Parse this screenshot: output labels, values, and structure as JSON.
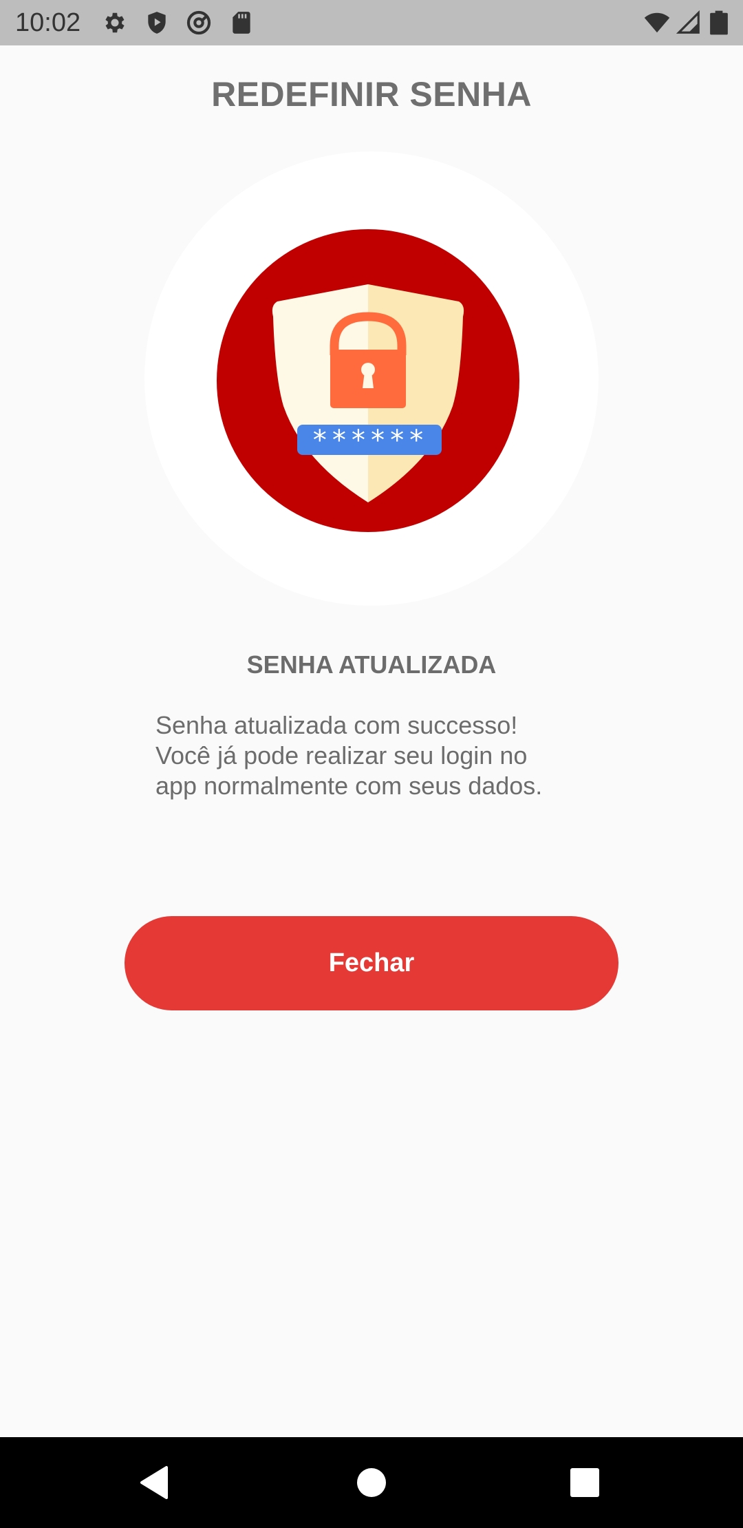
{
  "status_bar": {
    "time": "10:02",
    "icons_left": [
      "gear-icon",
      "shield-play-icon",
      "at-sign-icon",
      "sd-card-icon"
    ],
    "icons_right": [
      "wifi-icon",
      "signal-icon",
      "battery-icon"
    ]
  },
  "header": {
    "title": "REDEFINIR SENHA"
  },
  "hero": {
    "icon": "shield-lock-icon",
    "password_mask": "******",
    "colors": {
      "outer_circle": "#ffffff",
      "red_circle": "#c00000",
      "shield_light": "#fef8e6",
      "shield_dark": "#fce8b4",
      "padlock": "#ff6b3d",
      "password_field": "#4a86e8"
    }
  },
  "result": {
    "heading": "SENHA ATUALIZADA",
    "message_lines": [
      "Senha atualizada com successo!",
      "Você já pode realizar seu login no",
      "app normalmente com seus dados."
    ]
  },
  "actions": {
    "close_label": "Fechar",
    "close_color": "#e53935"
  },
  "nav_bar": {
    "buttons": [
      "back-icon",
      "home-icon",
      "recents-icon"
    ]
  }
}
